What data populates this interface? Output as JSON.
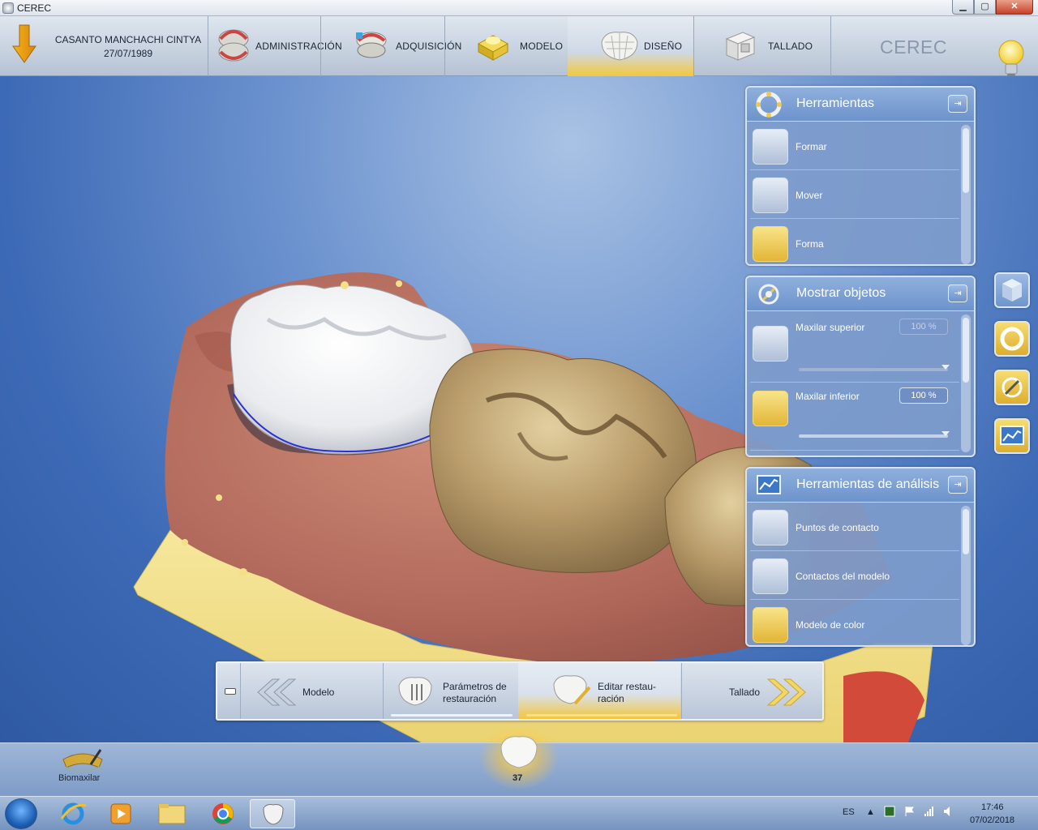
{
  "window": {
    "title": "CEREC",
    "controls": {
      "minimize": "▁",
      "maximize": "▢",
      "close": "✕"
    }
  },
  "patient": {
    "name": "CASANTO MANCHACHI CINTYA",
    "dob": "27/07/1989"
  },
  "phases": [
    {
      "label": "ADMINISTRACIÓN",
      "icon": "dental-arch-icon"
    },
    {
      "label": "ADQUISICIÓN",
      "icon": "scan-arch-icon"
    },
    {
      "label": "MODELO",
      "icon": "model-block-icon"
    },
    {
      "label": "DISEÑO",
      "icon": "crown-mesh-icon",
      "active": true
    },
    {
      "label": "TALLADO",
      "icon": "milling-unit-icon"
    }
  ],
  "brand": "CEREC",
  "panels": {
    "tools": {
      "title": "Herramientas",
      "items": [
        "Formar",
        "Mover",
        "Forma"
      ]
    },
    "objects": {
      "title": "Mostrar objetos",
      "items": [
        {
          "label": "Maxilar superior",
          "value": "100 %"
        },
        {
          "label": "Maxilar inferior",
          "value": "100 %"
        }
      ]
    },
    "analysis": {
      "title": "Herramientas de análisis",
      "items": [
        "Puntos de contacto",
        "Contactos del modelo",
        "Modelo de color"
      ]
    }
  },
  "workflow": {
    "back": "Modelo",
    "params": "Parámetros de\nrestauración",
    "edit": "Editar restau-\nración",
    "next": "Tallado"
  },
  "bottombar": {
    "biomaxilar": "Biomaxilar",
    "tooth_number": "37"
  },
  "taskbar": {
    "lang": "ES",
    "time": "17:46",
    "date": "07/02/2018"
  },
  "colors": {
    "accent_gold": "#f3c63e",
    "panel_blue": "#7e9ccc",
    "viewport_blue": "#3d6ab6"
  }
}
